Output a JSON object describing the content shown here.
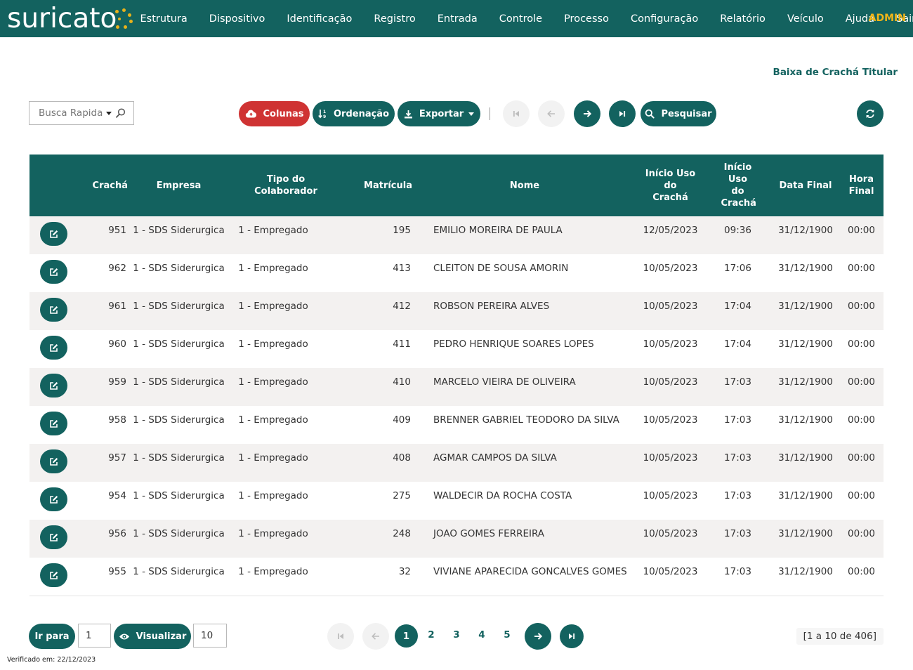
{
  "app": {
    "logo_text": "suricato",
    "user_label": "ADMIN",
    "brand_color": "#13625f",
    "accent_color": "#f2b618",
    "danger_color": "#cf3333"
  },
  "nav": {
    "items": [
      "Estrutura",
      "Dispositivo",
      "Identificação",
      "Registro",
      "Entrada",
      "Controle",
      "Processo",
      "Configuração",
      "Relatório",
      "Veículo",
      "Ajuda",
      "Sair"
    ]
  },
  "page": {
    "title": "Baixa de Crachá Titular"
  },
  "toolbar": {
    "search_placeholder": "Busca Rapida",
    "columns_label": "Colunas",
    "sort_label": "Ordenação",
    "export_label": "Exportar",
    "search_label": "Pesquisar",
    "icons": [
      "cloud-icon",
      "sort-icon",
      "download-icon",
      "first-page-icon",
      "prev-page-icon",
      "next-page-icon",
      "last-page-icon",
      "search-icon",
      "refresh-icon"
    ]
  },
  "table": {
    "headers": [
      "Crachá",
      "Empresa",
      "Tipo do Colaborador",
      "Matrícula",
      "Nome",
      "Início Uso do Crachá",
      "Início Uso do Crachá",
      "Data Final",
      "Hora Final"
    ],
    "rows": [
      [
        "951",
        "1 - SDS Siderurgica",
        "1 - Empregado",
        "195",
        "EMILIO MOREIRA DE PAULA",
        "12/05/2023",
        "09:36",
        "31/12/1900",
        "00:00"
      ],
      [
        "962",
        "1 - SDS Siderurgica",
        "1 - Empregado",
        "413",
        "CLEITON DE SOUSA AMORIN",
        "10/05/2023",
        "17:06",
        "31/12/1900",
        "00:00"
      ],
      [
        "961",
        "1 - SDS Siderurgica",
        "1 - Empregado",
        "412",
        "ROBSON PEREIRA ALVES",
        "10/05/2023",
        "17:04",
        "31/12/1900",
        "00:00"
      ],
      [
        "960",
        "1 - SDS Siderurgica",
        "1 - Empregado",
        "411",
        "PEDRO HENRIQUE SOARES LOPES",
        "10/05/2023",
        "17:04",
        "31/12/1900",
        "00:00"
      ],
      [
        "959",
        "1 - SDS Siderurgica",
        "1 - Empregado",
        "410",
        "MARCELO VIEIRA DE OLIVEIRA",
        "10/05/2023",
        "17:03",
        "31/12/1900",
        "00:00"
      ],
      [
        "958",
        "1 - SDS Siderurgica",
        "1 - Empregado",
        "409",
        "BRENNER GABRIEL TEODORO DA SILVA",
        "10/05/2023",
        "17:03",
        "31/12/1900",
        "00:00"
      ],
      [
        "957",
        "1 - SDS Siderurgica",
        "1 - Empregado",
        "408",
        "AGMAR CAMPOS DA SILVA",
        "10/05/2023",
        "17:03",
        "31/12/1900",
        "00:00"
      ],
      [
        "954",
        "1 - SDS Siderurgica",
        "1 - Empregado",
        "275",
        "WALDECIR DA ROCHA COSTA",
        "10/05/2023",
        "17:03",
        "31/12/1900",
        "00:00"
      ],
      [
        "956",
        "1 - SDS Siderurgica",
        "1 - Empregado",
        "248",
        "JOAO GOMES FERREIRA",
        "10/05/2023",
        "17:03",
        "31/12/1900",
        "00:00"
      ],
      [
        "955",
        "1 - SDS Siderurgica",
        "1 - Empregado",
        "32",
        "VIVIANE APARECIDA GONCALVES GOMES",
        "10/05/2023",
        "17:03",
        "31/12/1900",
        "00:00"
      ]
    ]
  },
  "pagination": {
    "goto_label": "Ir para",
    "goto_value": "1",
    "view_label": "Visualizar",
    "view_value": "10",
    "current_page": "1",
    "pages": [
      "2",
      "3",
      "4",
      "5"
    ],
    "status": "[1 a 10 de 406]"
  },
  "footer": {
    "verified": "Verificado em: 22/12/2023"
  }
}
